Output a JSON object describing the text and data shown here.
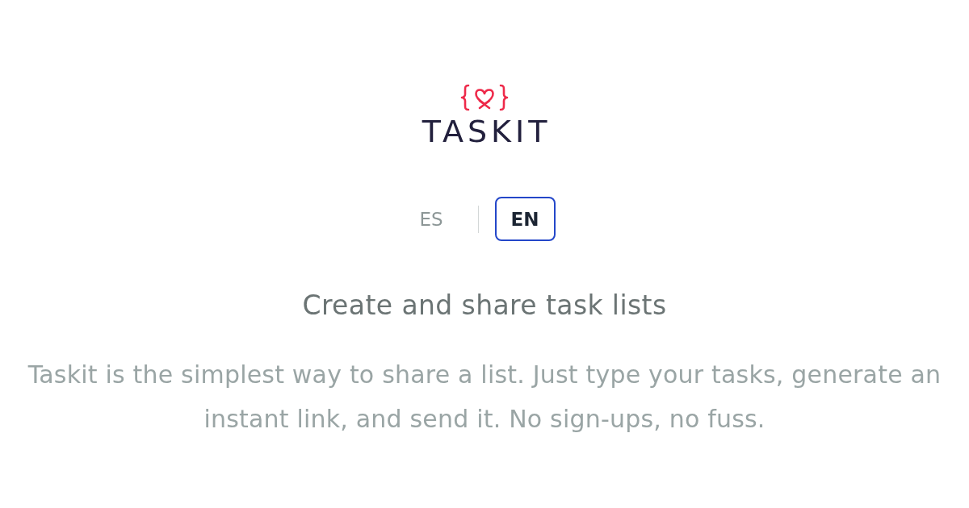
{
  "logo": {
    "wordmark": "TASKIT"
  },
  "languages": [
    {
      "label": "ES",
      "selected": false
    },
    {
      "label": "EN",
      "selected": true
    }
  ],
  "heading": "Create and share task lists",
  "description": "Taskit is the simplest way to share a list. Just type your tasks, generate an instant link, and send it. No sign-ups, no fuss."
}
